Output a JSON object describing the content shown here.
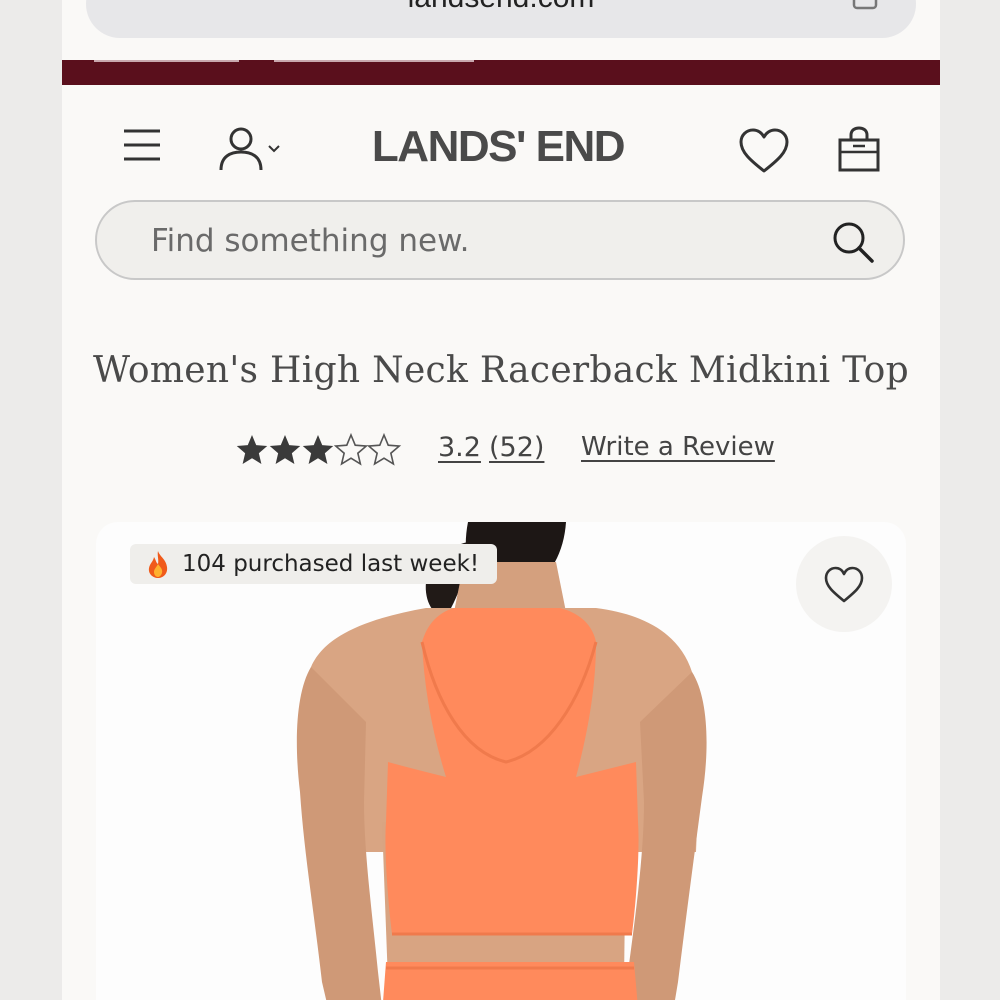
{
  "browser": {
    "url": "landsend.com"
  },
  "header": {
    "logo": "LANDS' END",
    "icons": [
      "menu-icon",
      "account-icon",
      "chevron-down-icon",
      "heart-icon",
      "shopping-bag-icon"
    ]
  },
  "search": {
    "placeholder": "Find something new."
  },
  "product": {
    "title": "Women's High Neck Racerback Midkini Top",
    "rating": {
      "stars_value": 3.2,
      "stars_max": 5,
      "value_label": "3.2",
      "count_label": "(52)",
      "write_review_label": "Write a Review"
    },
    "badge": {
      "icon": "fire-icon",
      "text": "104 purchased last week!"
    },
    "favorite_icon": "heart-icon"
  },
  "colors": {
    "promo_bar": "#5a0f1c",
    "text_dark": "#4a4a4a",
    "product_color": "#ff8a5c"
  }
}
